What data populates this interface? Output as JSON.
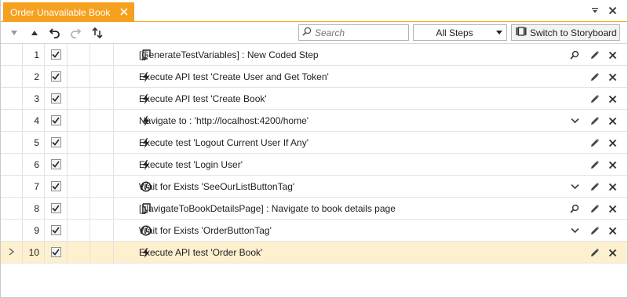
{
  "tab": {
    "title": "Order Unavailable Book"
  },
  "toolbar": {
    "search_placeholder": "Search",
    "filter_selected": "All Steps",
    "storyboard_label": "Switch to Storyboard"
  },
  "steps": [
    {
      "num": "1",
      "text": "[GenerateTestVariables] : New Coded Step",
      "icon": "coded-step-icon",
      "extra": "magnifier-icon"
    },
    {
      "num": "2",
      "text": "Execute API test 'Create User and Get Token'",
      "icon": "lightning-icon",
      "extra": ""
    },
    {
      "num": "3",
      "text": "Execute API test 'Create Book'",
      "icon": "lightning-icon",
      "extra": ""
    },
    {
      "num": "4",
      "text": "Navigate to : 'http://localhost:4200/home'",
      "icon": "lightning-icon",
      "extra": "chevron-down-icon"
    },
    {
      "num": "5",
      "text": "Execute test 'Logout Current User If Any'",
      "icon": "lightning-icon",
      "extra": ""
    },
    {
      "num": "6",
      "text": "Execute test 'Login User'",
      "icon": "lightning-icon",
      "extra": ""
    },
    {
      "num": "7",
      "text": "Wait for Exists 'SeeOurListButtonTag'",
      "icon": "clock-icon",
      "extra": "chevron-down-icon"
    },
    {
      "num": "8",
      "text": "[NavigateToBookDetailsPage] : Navigate to book details page",
      "icon": "coded-step-icon",
      "extra": "magnifier-icon"
    },
    {
      "num": "9",
      "text": "Wait for Exists 'OrderButtonTag'",
      "icon": "clock-icon",
      "extra": "chevron-down-icon"
    },
    {
      "num": "10",
      "text": "Execute API test 'Order Book'",
      "icon": "lightning-icon",
      "extra": "",
      "selected": true
    }
  ],
  "colors": {
    "tab_accent": "#f5a01e",
    "selected_row": "#fdf0cf"
  }
}
